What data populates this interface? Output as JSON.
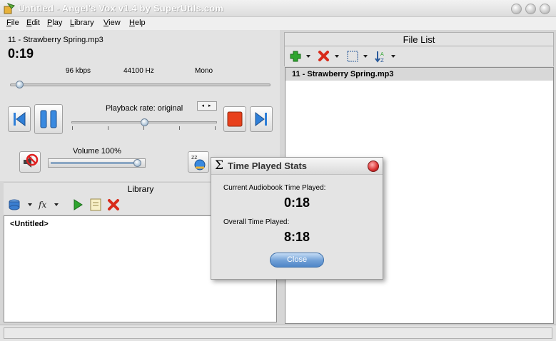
{
  "window": {
    "title": "Untitled - Angel's Vox v1.4 by SuperUtils.com"
  },
  "menu": [
    "File",
    "Edit",
    "Play",
    "Library",
    "View",
    "Help"
  ],
  "player": {
    "track": "11 - Strawberry Spring.mp3",
    "time": "0:19",
    "bitrate": "96 kbps",
    "samplerate": "44100 Hz",
    "channels": "Mono",
    "seek_fraction": 0.02,
    "rate_label": "Playback rate: original",
    "rate_fraction": 0.5,
    "rate_spin": "◂ ▸",
    "volume_label": "Volume 100%",
    "volume_fraction": 1.0
  },
  "library": {
    "header": "Library",
    "items": [
      "<Untitled>"
    ]
  },
  "filelist": {
    "header": "File List",
    "items": [
      "11 - Strawberry Spring.mp3"
    ]
  },
  "dialog": {
    "title": "Time Played Stats",
    "sigma": "Σ",
    "current_label": "Current Audiobook Time Played:",
    "current_value": "0:18",
    "overall_label": "Overall Time Played:",
    "overall_value": "8:18",
    "close_label": "Close"
  },
  "colors": {
    "accent_blue": "#2f7fd8",
    "stop_red": "#e8401c",
    "add_green": "#2ea52e",
    "delete_red": "#d82a1a"
  },
  "icons": {
    "prev": "skip-back-icon",
    "pause": "pause-icon",
    "stop": "stop-icon",
    "next": "skip-forward-icon",
    "mute": "mute-icon",
    "sleep": "sleep-icon"
  }
}
